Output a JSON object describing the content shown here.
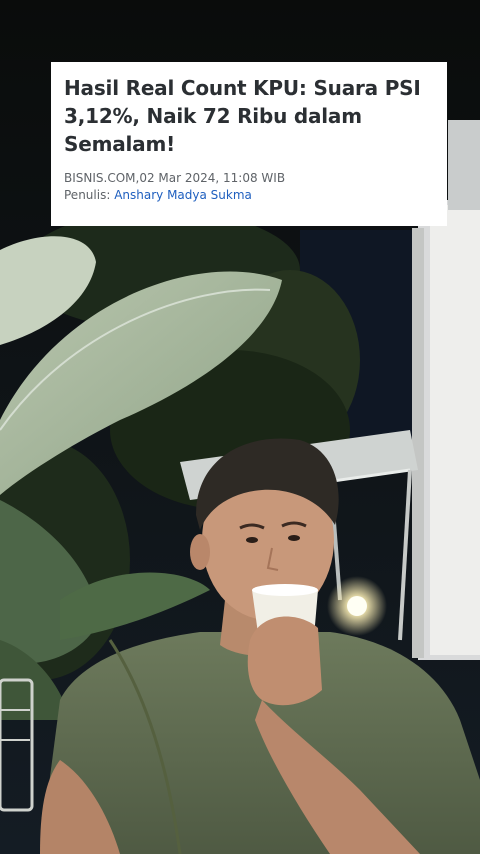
{
  "article": {
    "headline": "Hasil Real Count KPU: Suara PSI 3,12%, Naik 72 Ribu dalam Semalam!",
    "source_date": "BISNIS.COM,02 Mar 2024, 11:08 WIB",
    "writer_label": "Penulis:",
    "writer_name": "Anshary Madya Sukma"
  },
  "colors": {
    "card_bg": "#ffffff",
    "headline": "#2b2f33",
    "meta": "#5f6368",
    "author_link": "#1f5fbf"
  }
}
